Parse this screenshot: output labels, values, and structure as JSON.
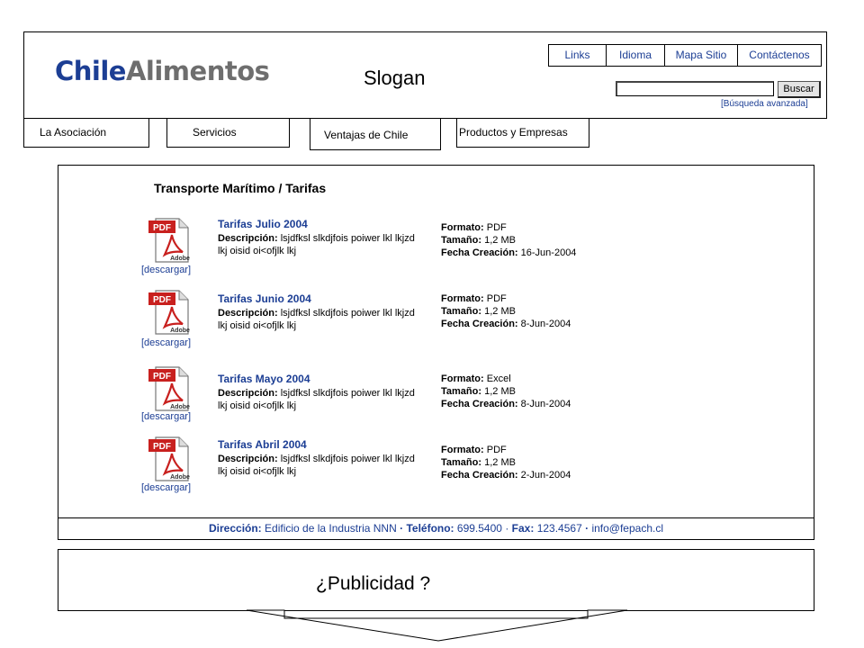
{
  "header": {
    "logo_part1": "Chile",
    "logo_part2": "Alimentos",
    "slogan": "Slogan",
    "top_links": [
      "Links",
      "Idioma",
      "Mapa Sitio",
      "Contáctenos"
    ],
    "search": {
      "value": "",
      "button_label": "Buscar",
      "advanced_label": "[Búsqueda avanzada]"
    }
  },
  "nav": {
    "tabs": [
      "La Asociación",
      "Servicios",
      "Ventajas de Chile",
      "Productos y Empresas"
    ]
  },
  "main": {
    "title": "Transporte Marítimo  /  Tarifas",
    "download_label": "[descargar]",
    "labels": {
      "description": "Descripción:",
      "format": "Formato:",
      "size": "Tamaño:",
      "created": "Fecha Creación:"
    },
    "icon_text": {
      "badge": "PDF",
      "brand": "Adobe"
    },
    "documents": [
      {
        "title": "Tarifas Julio 2004",
        "description": "lsjdfksl slkdjfois poiwer lkl lkjzd lkj oisid oi<ofjlk lkj",
        "format": "PDF",
        "size": "1,2 MB",
        "created": "16-Jun-2004"
      },
      {
        "title": "Tarifas Junio 2004",
        "description": "lsjdfksl slkdjfois poiwer lkl lkjzd lkj oisid oi<ofjlk lkj",
        "format": "PDF",
        "size": "1,2 MB",
        "created": "8-Jun-2004"
      },
      {
        "title": "Tarifas Mayo 2004",
        "description": "lsjdfksl slkdjfois poiwer lkl lkjzd lkj oisid oi<ofjlk lkj",
        "format": "Excel",
        "size": "1,2 MB",
        "created": "8-Jun-2004"
      },
      {
        "title": "Tarifas Abril 2004",
        "description": "lsjdfksl slkdjfois poiwer lkl lkjzd lkj oisid oi<ofjlk lkj",
        "format": "PDF",
        "size": "1,2 MB",
        "created": "2-Jun-2004"
      }
    ],
    "footer": {
      "address_label": "Dirección:",
      "address": "Edificio de la Industria NNN",
      "phone_label": "Teléfono:",
      "phone": "699.5400",
      "fax_label": "Fax:",
      "fax": "123.4567",
      "separator": "·",
      "email": "info@fepach.cl"
    }
  },
  "ad": {
    "text": "¿Publicidad ?"
  },
  "colors": {
    "link": "#1c3e94",
    "logo_gray": "#6e6e6e",
    "pdf_red": "#c8201e"
  }
}
